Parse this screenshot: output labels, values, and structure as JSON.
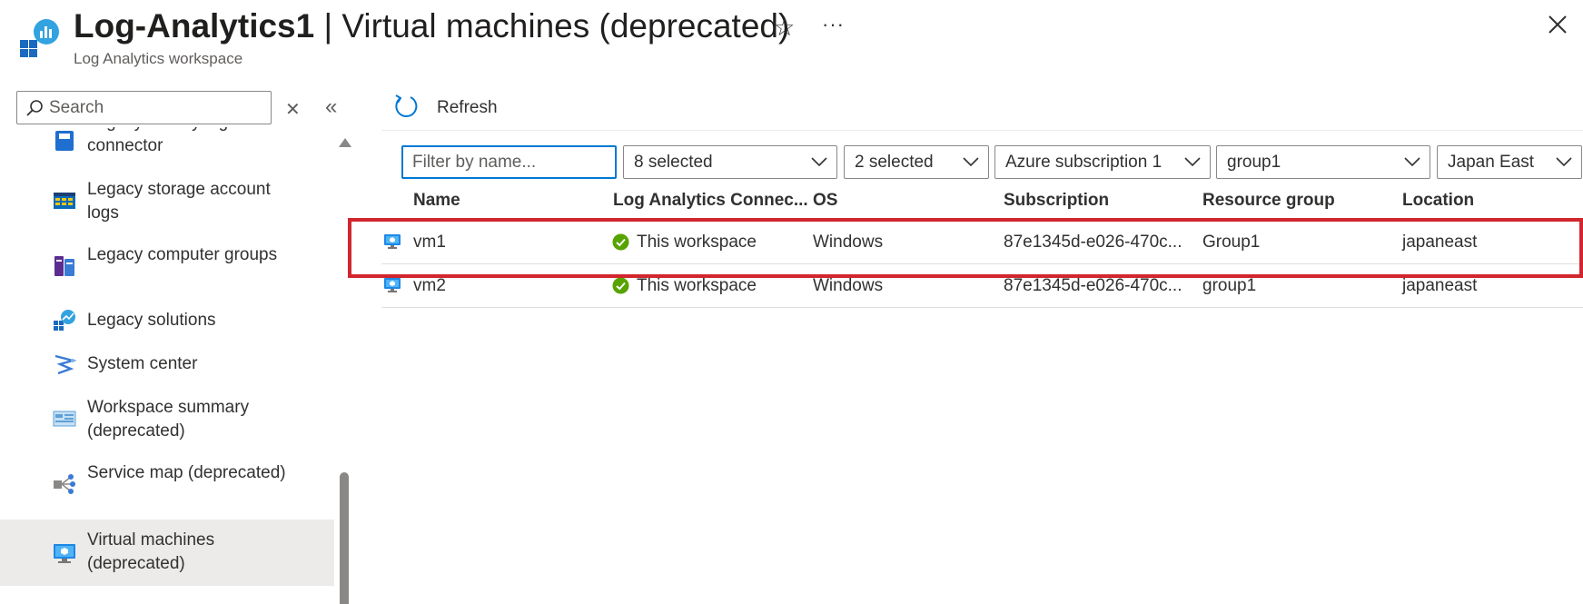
{
  "header": {
    "resource_name": "Log-Analytics1",
    "separator": " | ",
    "page_name": "Virtual machines (deprecated)",
    "subtitle": "Log Analytics workspace",
    "favorite_glyph": "☆",
    "more_glyph": "···"
  },
  "sidebar": {
    "search": {
      "placeholder": "Search"
    },
    "clear_glyph": "✕",
    "collapse_glyph": "«",
    "items": [
      {
        "label": "Legacy activity log connector",
        "icon": "legacy-activity-log-icon",
        "active": false
      },
      {
        "label": "Legacy storage account logs",
        "icon": "storage-table-icon",
        "active": false
      },
      {
        "label": "Legacy computer groups",
        "icon": "computer-groups-icon",
        "active": false
      },
      {
        "label": "Legacy solutions",
        "icon": "solutions-icon",
        "active": false
      },
      {
        "label": "System center",
        "icon": "system-center-icon",
        "active": false
      },
      {
        "label": "Workspace summary (deprecated)",
        "icon": "workspace-summary-icon",
        "active": false
      },
      {
        "label": "Service map (deprecated)",
        "icon": "service-map-icon",
        "active": false
      },
      {
        "label": "Virtual machines (deprecated)",
        "icon": "virtual-machine-icon",
        "active": true
      }
    ]
  },
  "toolbar": {
    "refresh_label": "Refresh"
  },
  "filters": {
    "name_placeholder": "Filter by name...",
    "dropdowns": [
      "8 selected",
      "2 selected",
      "Azure subscription 1",
      "group1",
      "Japan East"
    ]
  },
  "grid": {
    "columns": [
      "Name",
      "Log Analytics Connec...",
      "OS",
      "Subscription",
      "Resource group",
      "Location"
    ],
    "rows": [
      {
        "name": "vm1",
        "connection": "This workspace",
        "os": "Windows",
        "subscription": "87e1345d-e026-470c...",
        "resource_group": "Group1",
        "location": "japaneast"
      },
      {
        "name": "vm2",
        "connection": "This workspace",
        "os": "Windows",
        "subscription": "87e1345d-e026-470c...",
        "resource_group": "group1",
        "location": "japaneast"
      }
    ]
  },
  "colors": {
    "accent": "#0078d4",
    "highlight": "#d1262e",
    "success": "#57a300",
    "active_nav_bg": "#edebe9"
  }
}
